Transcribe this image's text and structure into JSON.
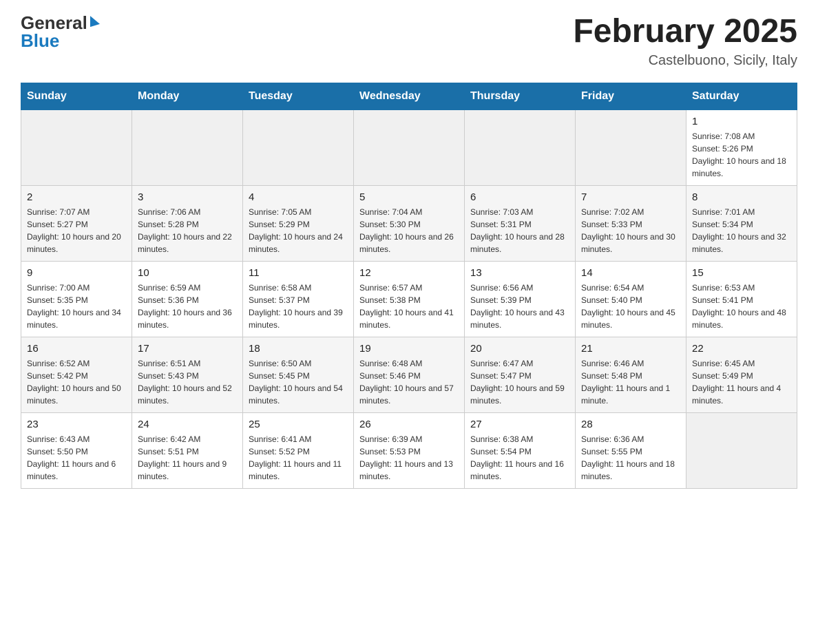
{
  "header": {
    "logo": {
      "top": "General",
      "bottom": "Blue"
    },
    "title": "February 2025",
    "location": "Castelbuono, Sicily, Italy"
  },
  "days_of_week": [
    "Sunday",
    "Monday",
    "Tuesday",
    "Wednesday",
    "Thursday",
    "Friday",
    "Saturday"
  ],
  "weeks": [
    [
      {
        "day": "",
        "info": ""
      },
      {
        "day": "",
        "info": ""
      },
      {
        "day": "",
        "info": ""
      },
      {
        "day": "",
        "info": ""
      },
      {
        "day": "",
        "info": ""
      },
      {
        "day": "",
        "info": ""
      },
      {
        "day": "1",
        "info": "Sunrise: 7:08 AM\nSunset: 5:26 PM\nDaylight: 10 hours and 18 minutes."
      }
    ],
    [
      {
        "day": "2",
        "info": "Sunrise: 7:07 AM\nSunset: 5:27 PM\nDaylight: 10 hours and 20 minutes."
      },
      {
        "day": "3",
        "info": "Sunrise: 7:06 AM\nSunset: 5:28 PM\nDaylight: 10 hours and 22 minutes."
      },
      {
        "day": "4",
        "info": "Sunrise: 7:05 AM\nSunset: 5:29 PM\nDaylight: 10 hours and 24 minutes."
      },
      {
        "day": "5",
        "info": "Sunrise: 7:04 AM\nSunset: 5:30 PM\nDaylight: 10 hours and 26 minutes."
      },
      {
        "day": "6",
        "info": "Sunrise: 7:03 AM\nSunset: 5:31 PM\nDaylight: 10 hours and 28 minutes."
      },
      {
        "day": "7",
        "info": "Sunrise: 7:02 AM\nSunset: 5:33 PM\nDaylight: 10 hours and 30 minutes."
      },
      {
        "day": "8",
        "info": "Sunrise: 7:01 AM\nSunset: 5:34 PM\nDaylight: 10 hours and 32 minutes."
      }
    ],
    [
      {
        "day": "9",
        "info": "Sunrise: 7:00 AM\nSunset: 5:35 PM\nDaylight: 10 hours and 34 minutes."
      },
      {
        "day": "10",
        "info": "Sunrise: 6:59 AM\nSunset: 5:36 PM\nDaylight: 10 hours and 36 minutes."
      },
      {
        "day": "11",
        "info": "Sunrise: 6:58 AM\nSunset: 5:37 PM\nDaylight: 10 hours and 39 minutes."
      },
      {
        "day": "12",
        "info": "Sunrise: 6:57 AM\nSunset: 5:38 PM\nDaylight: 10 hours and 41 minutes."
      },
      {
        "day": "13",
        "info": "Sunrise: 6:56 AM\nSunset: 5:39 PM\nDaylight: 10 hours and 43 minutes."
      },
      {
        "day": "14",
        "info": "Sunrise: 6:54 AM\nSunset: 5:40 PM\nDaylight: 10 hours and 45 minutes."
      },
      {
        "day": "15",
        "info": "Sunrise: 6:53 AM\nSunset: 5:41 PM\nDaylight: 10 hours and 48 minutes."
      }
    ],
    [
      {
        "day": "16",
        "info": "Sunrise: 6:52 AM\nSunset: 5:42 PM\nDaylight: 10 hours and 50 minutes."
      },
      {
        "day": "17",
        "info": "Sunrise: 6:51 AM\nSunset: 5:43 PM\nDaylight: 10 hours and 52 minutes."
      },
      {
        "day": "18",
        "info": "Sunrise: 6:50 AM\nSunset: 5:45 PM\nDaylight: 10 hours and 54 minutes."
      },
      {
        "day": "19",
        "info": "Sunrise: 6:48 AM\nSunset: 5:46 PM\nDaylight: 10 hours and 57 minutes."
      },
      {
        "day": "20",
        "info": "Sunrise: 6:47 AM\nSunset: 5:47 PM\nDaylight: 10 hours and 59 minutes."
      },
      {
        "day": "21",
        "info": "Sunrise: 6:46 AM\nSunset: 5:48 PM\nDaylight: 11 hours and 1 minute."
      },
      {
        "day": "22",
        "info": "Sunrise: 6:45 AM\nSunset: 5:49 PM\nDaylight: 11 hours and 4 minutes."
      }
    ],
    [
      {
        "day": "23",
        "info": "Sunrise: 6:43 AM\nSunset: 5:50 PM\nDaylight: 11 hours and 6 minutes."
      },
      {
        "day": "24",
        "info": "Sunrise: 6:42 AM\nSunset: 5:51 PM\nDaylight: 11 hours and 9 minutes."
      },
      {
        "day": "25",
        "info": "Sunrise: 6:41 AM\nSunset: 5:52 PM\nDaylight: 11 hours and 11 minutes."
      },
      {
        "day": "26",
        "info": "Sunrise: 6:39 AM\nSunset: 5:53 PM\nDaylight: 11 hours and 13 minutes."
      },
      {
        "day": "27",
        "info": "Sunrise: 6:38 AM\nSunset: 5:54 PM\nDaylight: 11 hours and 16 minutes."
      },
      {
        "day": "28",
        "info": "Sunrise: 6:36 AM\nSunset: 5:55 PM\nDaylight: 11 hours and 18 minutes."
      },
      {
        "day": "",
        "info": ""
      }
    ]
  ]
}
